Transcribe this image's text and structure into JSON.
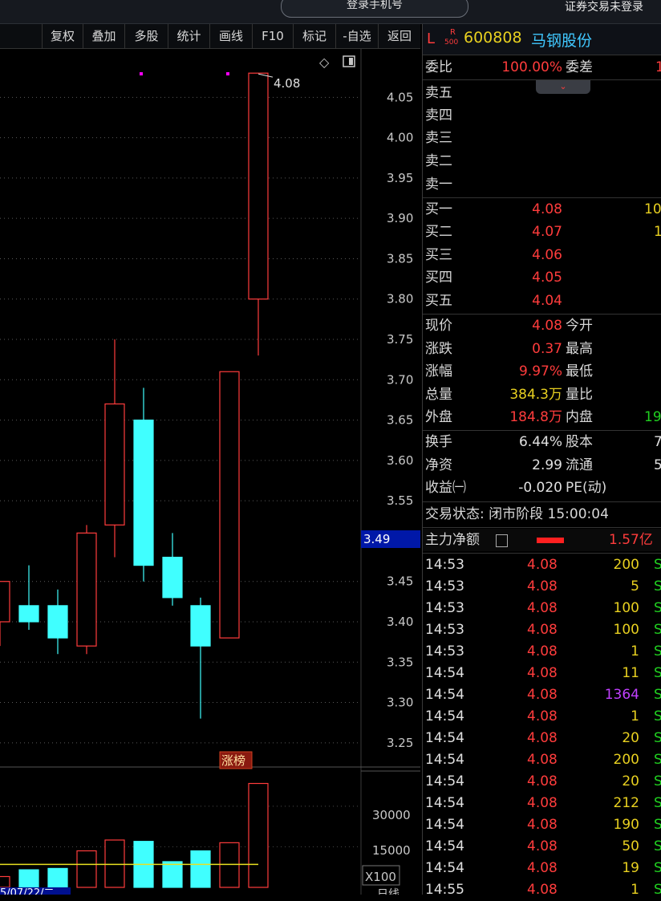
{
  "topbar": {
    "login_label": "登录手机号",
    "trade_status": "证券交易未登录"
  },
  "toolbar": {
    "items": [
      "复权",
      "叠加",
      "多股",
      "统计",
      "画线",
      "F10",
      "标记",
      "-自选",
      "返回"
    ]
  },
  "chart": {
    "price_ticks": [
      "4.05",
      "4.00",
      "3.95",
      "3.90",
      "3.85",
      "3.80",
      "3.75",
      "3.70",
      "3.65",
      "3.60",
      "3.55",
      "3.45",
      "3.40",
      "3.35",
      "3.30",
      "3.25"
    ],
    "current_price_tag": "3.49",
    "high_label": "4.08",
    "limit_up_badge": "涨榜",
    "volume_ticks": [
      "30000",
      "15000"
    ],
    "volume_unit": "X100",
    "date_label": "5/07/22/二",
    "period_label": "日线",
    "colors": {
      "up": "#ff3c3c",
      "down": "#40ffff",
      "ma": "#e8e020",
      "marker": "#ff00ff"
    }
  },
  "chart_data": {
    "type": "candlestick",
    "ohlc": [
      {
        "open": 3.4,
        "high": 3.45,
        "low": 3.37,
        "close": 3.45
      },
      {
        "open": 3.42,
        "high": 3.47,
        "low": 3.39,
        "close": 3.4
      },
      {
        "open": 3.42,
        "high": 3.44,
        "low": 3.36,
        "close": 3.38
      },
      {
        "open": 3.37,
        "high": 3.52,
        "low": 3.36,
        "close": 3.51
      },
      {
        "open": 3.52,
        "high": 3.75,
        "low": 3.48,
        "close": 3.67
      },
      {
        "open": 3.65,
        "high": 3.69,
        "low": 3.45,
        "close": 3.47
      },
      {
        "open": 3.48,
        "high": 3.51,
        "low": 3.42,
        "close": 3.43
      },
      {
        "open": 3.42,
        "high": 3.43,
        "low": 3.28,
        "close": 3.37
      },
      {
        "open": 3.38,
        "high": 3.71,
        "low": 3.38,
        "close": 3.71
      },
      {
        "open": 3.8,
        "high": 4.08,
        "low": 3.73,
        "close": 4.08
      }
    ],
    "volume": [
      {
        "value": 4000,
        "dir": "up"
      },
      {
        "value": 6500,
        "dir": "down"
      },
      {
        "value": 7000,
        "dir": "down"
      },
      {
        "value": 13500,
        "dir": "up"
      },
      {
        "value": 17500,
        "dir": "up"
      },
      {
        "value": 17000,
        "dir": "down"
      },
      {
        "value": 9500,
        "dir": "down"
      },
      {
        "value": 13500,
        "dir": "down"
      },
      {
        "value": 16500,
        "dir": "up"
      },
      {
        "value": 38400,
        "dir": "up"
      }
    ],
    "volume_ma": 8500,
    "ylim": [
      3.22,
      4.11
    ],
    "volume_ylim": [
      0,
      43000
    ]
  },
  "quote": {
    "market_flag": "L",
    "r_flag": "R",
    "r_sub": "500",
    "code": "600808",
    "name": "马钢股份",
    "weibi_label": "委比",
    "weibi_value": "100.00%",
    "weicha_label": "委差",
    "weicha_value": "1",
    "asks": [
      {
        "label": "卖五"
      },
      {
        "label": "卖四"
      },
      {
        "label": "卖三"
      },
      {
        "label": "卖二"
      },
      {
        "label": "卖一"
      }
    ],
    "bids": [
      {
        "label": "买一",
        "price": "4.08",
        "vol": "10"
      },
      {
        "label": "买二",
        "price": "4.07",
        "vol": "1"
      },
      {
        "label": "买三",
        "price": "4.06",
        "vol": ""
      },
      {
        "label": "买四",
        "price": "4.05",
        "vol": ""
      },
      {
        "label": "买五",
        "price": "4.04",
        "vol": ""
      }
    ],
    "stats": [
      {
        "l1": "现价",
        "v1": "4.08",
        "c1": "red",
        "l2": "今开",
        "v2": "",
        "c2": "white"
      },
      {
        "l1": "涨跌",
        "v1": "0.37",
        "c1": "red",
        "l2": "最高",
        "v2": "",
        "c2": "white"
      },
      {
        "l1": "涨幅",
        "v1": "9.97%",
        "c1": "red",
        "l2": "最低",
        "v2": "",
        "c2": "white"
      },
      {
        "l1": "总量",
        "v1": "384.3万",
        "c1": "yellow",
        "l2": "量比",
        "v2": "",
        "c2": "white"
      },
      {
        "l1": "外盘",
        "v1": "184.8万",
        "c1": "red",
        "l2": "内盘",
        "v2": "19",
        "c2": "green"
      }
    ],
    "stats2": [
      {
        "l1": "换手",
        "v1": "6.44%",
        "l2": "股本",
        "v2": "7"
      },
      {
        "l1": "净资",
        "v1": "2.99",
        "l2": "流通",
        "v2": "5"
      },
      {
        "l1": "收益㈠",
        "v1": "-0.020",
        "l2": "PE(动)",
        "v2": ""
      }
    ],
    "trade_state": "交易状态: 闭市阶段 15:00:04",
    "main_flow_label": "主力净额",
    "main_flow_value": "1.57亿"
  },
  "ticks": [
    {
      "time": "14:53",
      "price": "4.08",
      "vol": "200",
      "c": "yellow",
      "flag": "S"
    },
    {
      "time": "14:53",
      "price": "4.08",
      "vol": "5",
      "c": "yellow",
      "flag": "S"
    },
    {
      "time": "14:53",
      "price": "4.08",
      "vol": "100",
      "c": "yellow",
      "flag": "S"
    },
    {
      "time": "14:53",
      "price": "4.08",
      "vol": "100",
      "c": "yellow",
      "flag": "S"
    },
    {
      "time": "14:53",
      "price": "4.08",
      "vol": "1",
      "c": "yellow",
      "flag": "S"
    },
    {
      "time": "14:54",
      "price": "4.08",
      "vol": "11",
      "c": "yellow",
      "flag": "S"
    },
    {
      "time": "14:54",
      "price": "4.08",
      "vol": "1364",
      "c": "purple",
      "flag": "S"
    },
    {
      "time": "14:54",
      "price": "4.08",
      "vol": "1",
      "c": "yellow",
      "flag": "S"
    },
    {
      "time": "14:54",
      "price": "4.08",
      "vol": "20",
      "c": "yellow",
      "flag": "S"
    },
    {
      "time": "14:54",
      "price": "4.08",
      "vol": "200",
      "c": "yellow",
      "flag": "S"
    },
    {
      "time": "14:54",
      "price": "4.08",
      "vol": "20",
      "c": "yellow",
      "flag": "S"
    },
    {
      "time": "14:54",
      "price": "4.08",
      "vol": "212",
      "c": "yellow",
      "flag": "S"
    },
    {
      "time": "14:54",
      "price": "4.08",
      "vol": "190",
      "c": "yellow",
      "flag": "S"
    },
    {
      "time": "14:54",
      "price": "4.08",
      "vol": "50",
      "c": "yellow",
      "flag": "S"
    },
    {
      "time": "14:54",
      "price": "4.08",
      "vol": "19",
      "c": "yellow",
      "flag": "S"
    },
    {
      "time": "14:55",
      "price": "4.08",
      "vol": "1",
      "c": "yellow",
      "flag": "S"
    }
  ]
}
